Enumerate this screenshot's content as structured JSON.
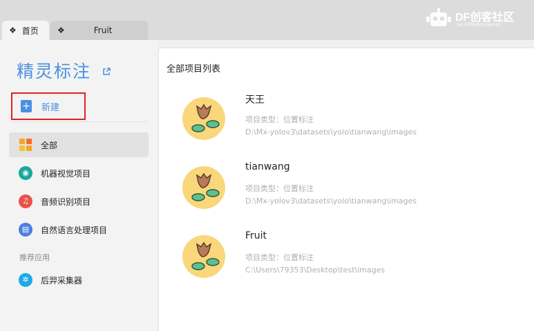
{
  "tabs": [
    {
      "label": "首页",
      "icon": "four-diamond-icon"
    },
    {
      "label": "Fruit",
      "icon": "four-diamond-icon"
    }
  ],
  "watermark": {
    "title": "DF创客社区",
    "url": "mc.DFRobot.com.cn"
  },
  "sidebar": {
    "app_title": "精灵标注",
    "new_label": "新建",
    "items": [
      {
        "label": "全部",
        "icon": "grid-icon"
      },
      {
        "label": "机器视觉项目",
        "icon": "vision-icon",
        "color": "#16a99a"
      },
      {
        "label": "音频识别项目",
        "icon": "music-icon",
        "color": "#e9524a"
      },
      {
        "label": "自然语言处理项目",
        "icon": "document-icon",
        "color": "#4a7fe0"
      }
    ],
    "section_label": "推荐应用",
    "apps": [
      {
        "label": "后羿采集器",
        "icon": "collector-icon",
        "color": "#1ea9e8"
      }
    ]
  },
  "main": {
    "title": "全部项目列表",
    "projects": [
      {
        "name": "天王",
        "type": "项目类型：位置标注",
        "path": "D:\\Mx-yolov3\\datasets\\yolo\\tianwang\\images"
      },
      {
        "name": "tianwang",
        "type": "项目类型：位置标注",
        "path": "D:\\Mx-yolov3\\datasets\\yolo\\tianwang\\images"
      },
      {
        "name": "Fruit",
        "type": "项目类型：位置标注",
        "path": "C:\\Users\\79353\\Desktop\\test\\images"
      }
    ]
  },
  "colors": {
    "accent": "#4a90e2",
    "highlight_border": "#e02020",
    "avatar_bg": "#f9d77a"
  }
}
